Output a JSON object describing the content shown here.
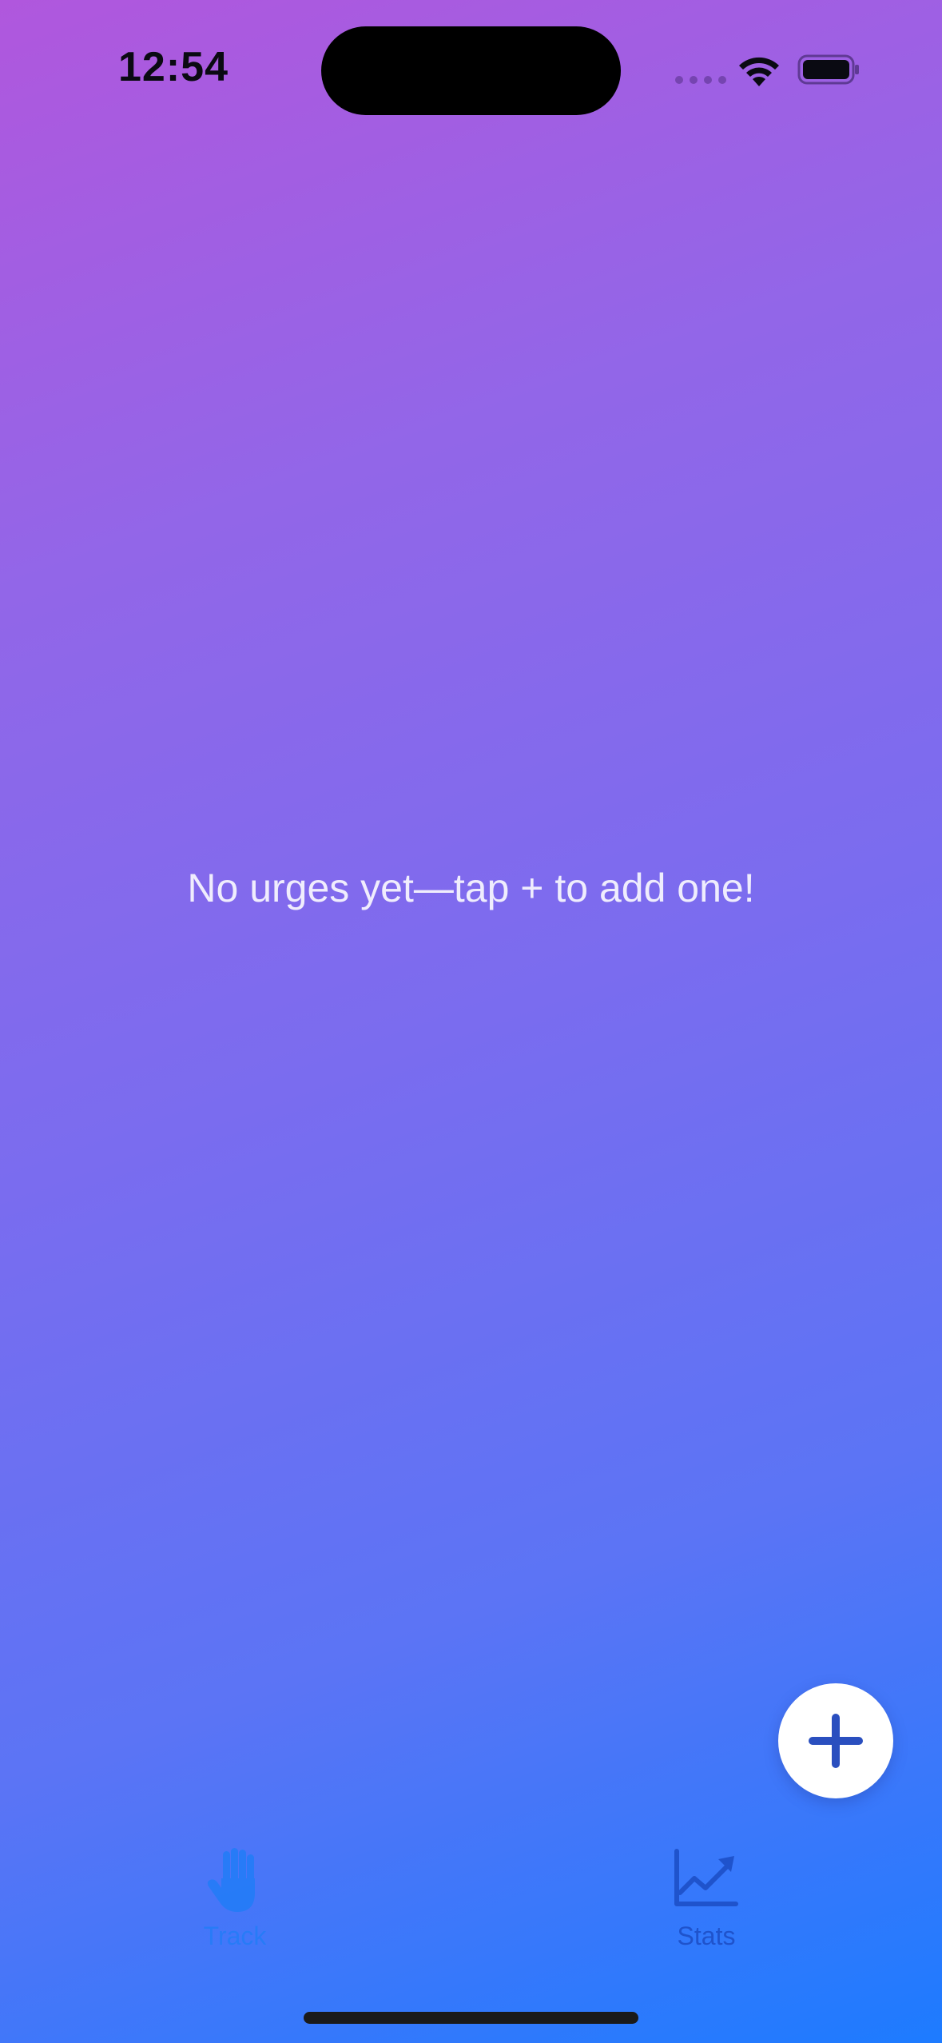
{
  "status_bar": {
    "time": "12:54",
    "signal_icon": "cellular-signal-icon",
    "wifi_icon": "wifi-icon",
    "battery_icon": "battery-icon"
  },
  "main": {
    "empty_message": "No urges yet—tap + to add one!"
  },
  "add_button": {
    "icon": "plus-icon"
  },
  "tab_bar": {
    "items": [
      {
        "label": "Track",
        "icon": "raised-hand-icon",
        "selected": true
      },
      {
        "label": "Stats",
        "icon": "line-chart-icon",
        "selected": false
      }
    ]
  },
  "colors": {
    "gradient_start": "#b057dd",
    "gradient_end": "#1d7bff",
    "track_tab": "#1f7df7",
    "stats_tab": "#1f53cc",
    "fab_plus": "#2a4fbf"
  }
}
